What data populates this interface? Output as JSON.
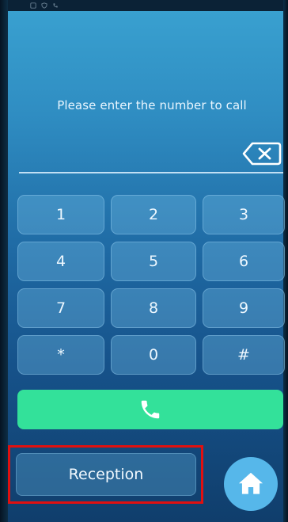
{
  "status_bar": {
    "icons": [
      "sim-icon",
      "shield-icon",
      "phone-icon"
    ]
  },
  "dialer": {
    "prompt": "Please enter the number to call",
    "entered_number": "",
    "backspace_icon": "backspace-icon"
  },
  "keypad": {
    "keys": [
      "1",
      "2",
      "3",
      "4",
      "5",
      "6",
      "7",
      "8",
      "9",
      "*",
      "0",
      "#"
    ]
  },
  "call": {
    "icon": "phone-handset-icon",
    "color": "#33e19a"
  },
  "reception": {
    "label": "Reception",
    "highlight_color": "#e01010"
  },
  "home": {
    "icon": "home-icon",
    "color": "#56b7ea"
  }
}
